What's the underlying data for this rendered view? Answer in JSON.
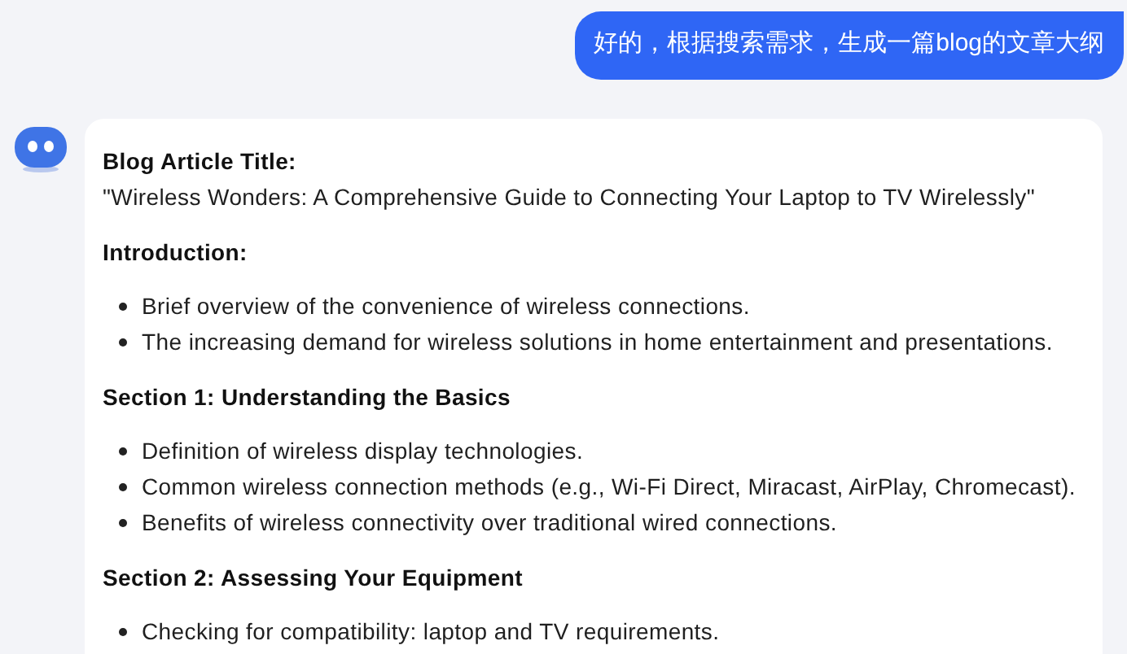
{
  "user_message": "好的，根据搜索需求，生成一篇blog的文章大纲",
  "reply": {
    "title_label": "Blog Article Title:",
    "title_text": "\"Wireless Wonders: A Comprehensive Guide to Connecting Your Laptop to TV Wirelessly\"",
    "sections": [
      {
        "heading": "Introduction:",
        "items": [
          "Brief overview of the convenience of wireless connections.",
          "The increasing demand for wireless solutions in home entertainment and presentations."
        ]
      },
      {
        "heading": "Section 1: Understanding the Basics",
        "items": [
          "Definition of wireless display technologies.",
          "Common wireless connection methods (e.g., Wi-Fi Direct, Miracast, AirPlay, Chromecast).",
          "Benefits of wireless connectivity over traditional wired connections."
        ]
      },
      {
        "heading": "Section 2: Assessing Your Equipment",
        "items": [
          "Checking for compatibility: laptop and TV requirements."
        ]
      }
    ]
  }
}
